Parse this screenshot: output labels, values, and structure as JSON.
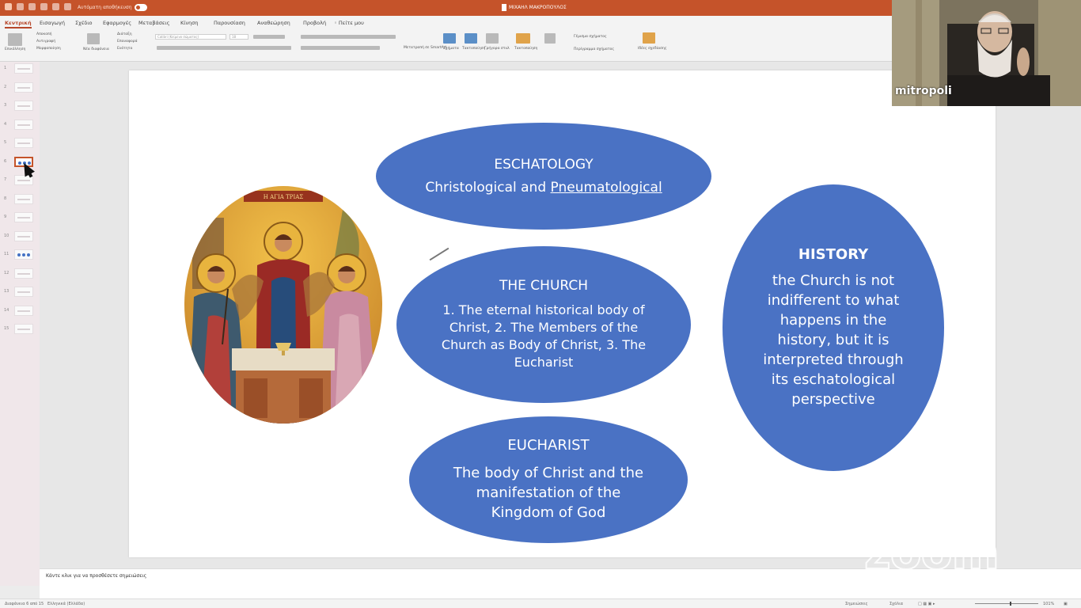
{
  "titlebar": {
    "autosave_label": "Αυτόματη αποθήκευση",
    "document_title": "ΜΙΧΑΗΛ ΜΑΚΡΟΠΟΥΛΟΣ"
  },
  "ribbon": {
    "tabs": [
      "Κεντρική",
      "Εισαγωγή",
      "Σχέδιο",
      "Εφαρμογές",
      "Μεταβάσεις",
      "Κίνηση",
      "Παρουσίαση",
      "Αναθεώρηση",
      "Προβολή",
      "Πείτε μου"
    ],
    "active_tab": "Κεντρική",
    "clipboard": {
      "paste": "Επικόλληση",
      "cut": "Αποκοπή",
      "copy": "Αντιγραφή",
      "format": "Μορφοποίηση"
    },
    "slides": {
      "new_slide": "Νέα διαφάνεια",
      "layout": "Διάταξη",
      "reset": "Επαναφορά",
      "section": "Ενότητα"
    },
    "font_placeholder": "Calibri (Κείμενο σώματος)",
    "font_size": "18",
    "drawing": {
      "shapes": "Σχήματα",
      "arrange": "Τακτοποίηση",
      "quick_styles": "Γρήγορα στυλ"
    },
    "editing": {
      "arrange": "Τακτοποίηση",
      "shape_fill": "Γέμισμα σχήματος",
      "shape_outline": "Περίγραμμα σχήματος"
    },
    "designer": "Ιδέες σχεδίασης",
    "convert": "Μετατροπή σε SmartArt"
  },
  "thumbnails": {
    "numbers": [
      "1",
      "2",
      "3",
      "4",
      "5",
      "6",
      "7",
      "8",
      "9",
      "10",
      "11",
      "12",
      "13",
      "14",
      "15"
    ],
    "selected_index": 6
  },
  "slide": {
    "eschatology": {
      "heading": "ESCHATOLOGY",
      "body_plain": "Christological and ",
      "body_underlined": "Pneumatological"
    },
    "church": {
      "heading": "THE CHURCH",
      "body": "1. The eternal historical body of Christ, 2. The Members of the Church as Body of Christ, 3. The  Eucharist"
    },
    "eucharist": {
      "heading": "EUCHARIST",
      "body": "The body of Christ and the manifestation of the Kingdom of God"
    },
    "history": {
      "heading": "HISTORY",
      "body": "the Church is not indifferent to what happens in the history, but it is interpreted through its eschatological perspective"
    },
    "icon_inscription": "Η ΑΓΙΑ ΤΡΙΑΣ"
  },
  "notes": {
    "placeholder": "Κάντε κλικ για να προσθέσετε σημειώσεις"
  },
  "status": {
    "slide_counter": "Διαφάνεια 6 από 15",
    "language": "Ελληνικά (Ελλάδα)",
    "notes_label": "Σημειώσεις",
    "comments_label": "Σχόλια",
    "zoom_level": "101%"
  },
  "video": {
    "participant_name": "mitropoli"
  },
  "watermark": {
    "text": "zoom"
  },
  "colors": {
    "titlebar": "#c5532a",
    "ellipse_fill": "#4a72c4",
    "slide_bg": "#ffffff"
  }
}
